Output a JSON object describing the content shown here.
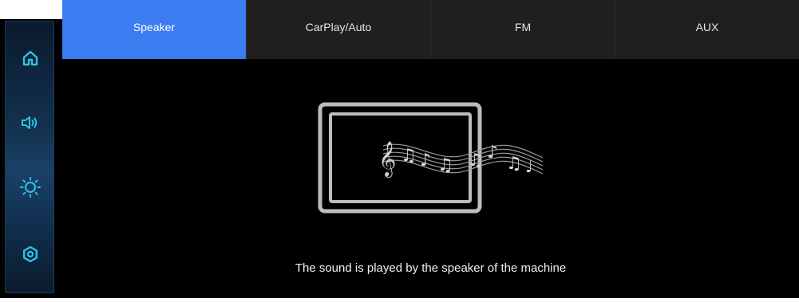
{
  "tabs": [
    {
      "label": "Speaker",
      "active": true
    },
    {
      "label": "CarPlay/Auto",
      "active": false
    },
    {
      "label": "FM",
      "active": false
    },
    {
      "label": "AUX",
      "active": false
    }
  ],
  "sidebar": {
    "items": [
      {
        "icon": "home-icon"
      },
      {
        "icon": "volume-icon"
      },
      {
        "icon": "brightness-icon"
      },
      {
        "icon": "settings-icon"
      }
    ]
  },
  "main": {
    "caption": "The sound is played by the speaker of the machine",
    "illustration_icon": "speaker-music-icon"
  },
  "colors": {
    "accent": "#3b7cf0",
    "sidebar_icon": "#2ec4e6",
    "tab_bg": "#1f1f1f",
    "background": "#000000"
  }
}
